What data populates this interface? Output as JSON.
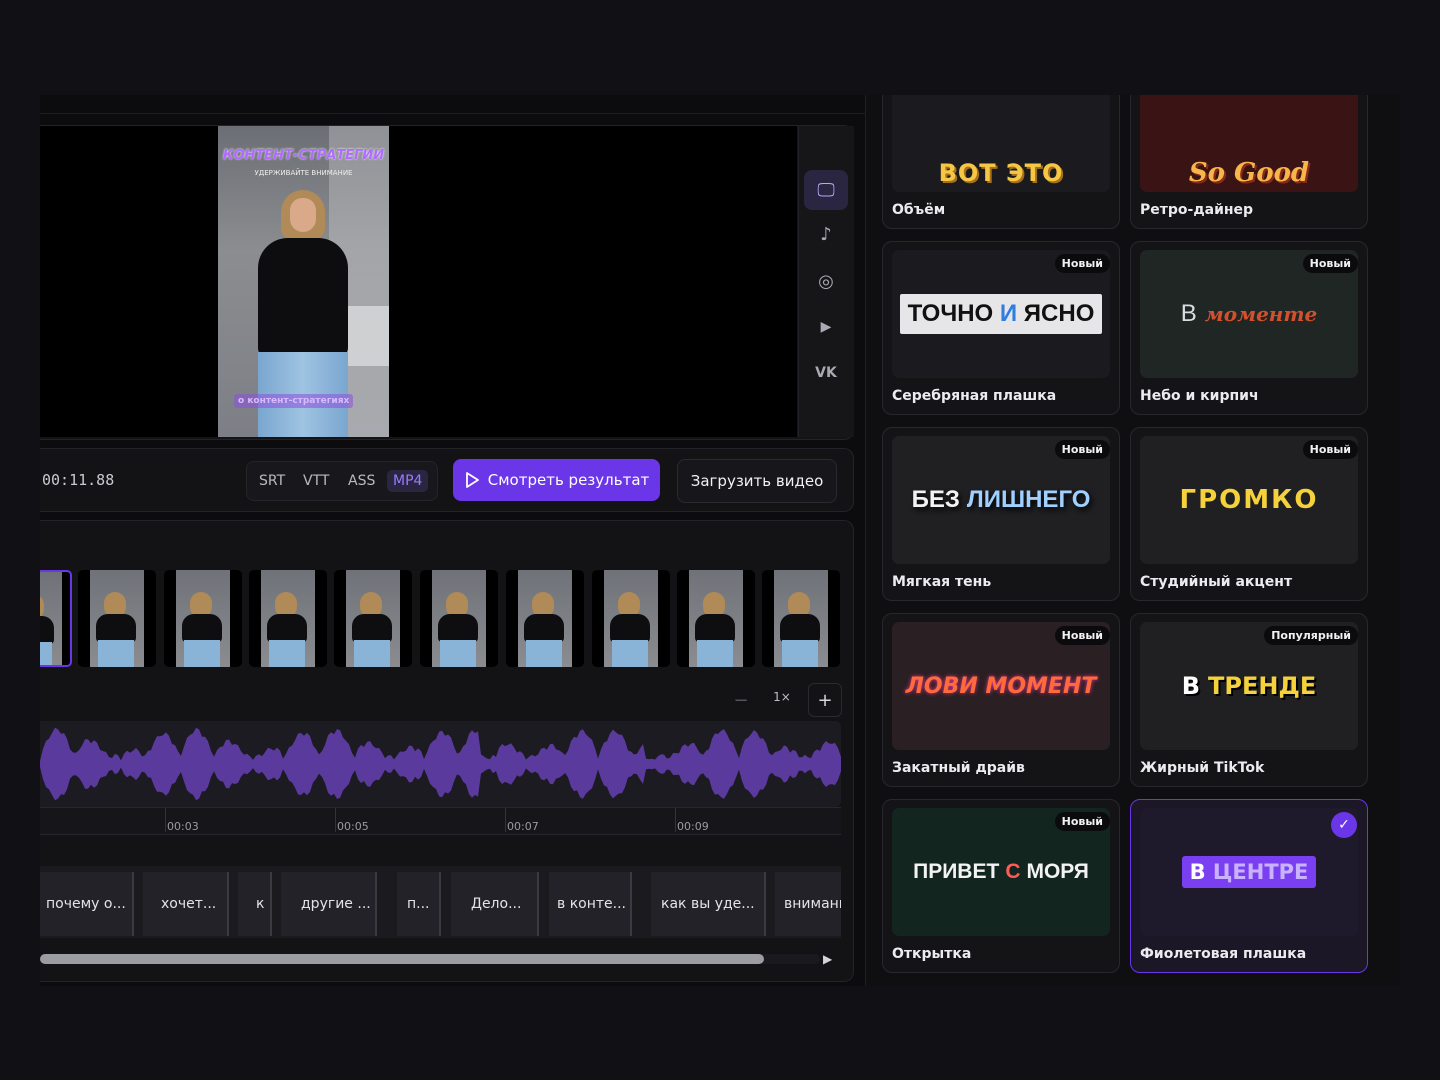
{
  "preview": {
    "video_title": "КОНТЕНТ-СТРАТЕГИИ",
    "video_subtitle": "УДЕРЖИВАЙТЕ ВНИМАНИЕ",
    "video_caption": "о контент-стратегиях",
    "platforms": [
      {
        "name": "desktop-icon",
        "glyph": "🖵",
        "active": true
      },
      {
        "name": "tiktok-icon",
        "glyph": "♪",
        "active": false
      },
      {
        "name": "instagram-icon",
        "glyph": "◎",
        "active": false
      },
      {
        "name": "youtube-icon",
        "glyph": "▶",
        "active": false
      },
      {
        "name": "vk-icon",
        "glyph": "VK",
        "active": false
      }
    ]
  },
  "controls": {
    "timecode": "00:11.88",
    "formats": [
      "SRT",
      "VTT",
      "ASS",
      "MP4"
    ],
    "active_format": "MP4",
    "watch_button": "Смотреть результат",
    "upload_button": "Загрузить видео"
  },
  "timeline": {
    "zoom_minus": "−",
    "zoom_value": "1×",
    "zoom_plus": "+",
    "ruler_labels": [
      "00:03",
      "00:05",
      "00:07",
      "00:09"
    ],
    "segments": [
      "почему о...",
      "хочет...",
      "к",
      "другие ...",
      "п...",
      "Дело...",
      "в конте...",
      "как вы уде...",
      "внимани"
    ]
  },
  "styles": [
    {
      "label": "Объём",
      "preview_text": "ВОТ ЭТО",
      "badge": "",
      "selected": false
    },
    {
      "label": "Ретро-дайнер",
      "preview_text": "So Good",
      "badge": "",
      "selected": false
    },
    {
      "label": "Серебряная плашка",
      "preview_text_a": "ТОЧНО",
      "preview_text_b": "И",
      "preview_text_c": "ЯСНО",
      "badge": "Новый",
      "selected": false
    },
    {
      "label": "Небо и кирпич",
      "preview_text_a": "В",
      "preview_text_b": "моменте",
      "badge": "Новый",
      "selected": false
    },
    {
      "label": "Мягкая тень",
      "preview_text_a": "БЕЗ",
      "preview_text_b": "ЛИШНЕГО",
      "badge": "Новый",
      "selected": false
    },
    {
      "label": "Студийный акцент",
      "preview_text": "ГРОМКО",
      "badge": "Новый",
      "selected": false
    },
    {
      "label": "Закатный драйв",
      "preview_text": "ЛОВИ МОМЕНТ",
      "badge": "Новый",
      "selected": false
    },
    {
      "label": "Жирный TikTok",
      "preview_text_a": "В",
      "preview_text_b": "ТРЕНДЕ",
      "badge": "Популярный",
      "selected": false
    },
    {
      "label": "Открытка",
      "preview_text_a": "ПРИВЕТ",
      "preview_text_b": "С",
      "preview_text_c": "МОРЯ",
      "badge": "Новый",
      "selected": false
    },
    {
      "label": "Фиолетовая плашка",
      "preview_text_a": "В",
      "preview_text_b": "ЦЕНТРЕ",
      "badge": "",
      "selected": true,
      "check": "✓"
    }
  ]
}
